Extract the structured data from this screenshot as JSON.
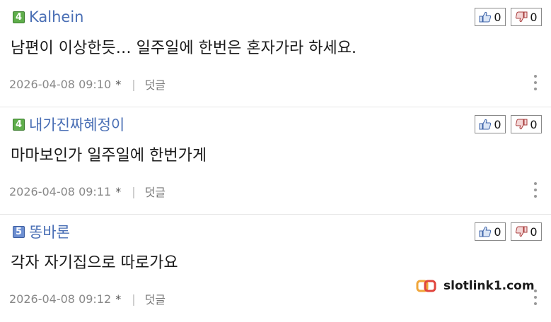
{
  "comments": [
    {
      "level": "4",
      "author": "Kalhein",
      "likes": "0",
      "dislikes": "0",
      "text": "남편이 이상한듯… 일주일에 한번은 혼자가라 하세요.",
      "timestamp": "2026-04-08 09:10",
      "star": "*",
      "separator": "|",
      "reply_label": "덧글"
    },
    {
      "level": "4",
      "author": "내가진짜혜정이",
      "likes": "0",
      "dislikes": "0",
      "text": "마마보인가 일주일에 한번가게",
      "timestamp": "2026-04-08 09:11",
      "star": "*",
      "separator": "|",
      "reply_label": "덧글"
    },
    {
      "level": "5",
      "author": "똥바론",
      "likes": "0",
      "dislikes": "0",
      "text": "각자 자기집으로 따로가요",
      "timestamp": "2026-04-08 09:12",
      "star": "*",
      "separator": "|",
      "reply_label": "덧글"
    }
  ],
  "watermark": {
    "text": "slotlink1.com"
  },
  "colors": {
    "author": "#4a6fb5",
    "level4": "#5fae4b",
    "level5": "#6d8fd1"
  },
  "icons": {
    "like": "thumbs-up-icon",
    "dislike": "thumbs-down-icon",
    "more": "kebab-menu-icon"
  }
}
